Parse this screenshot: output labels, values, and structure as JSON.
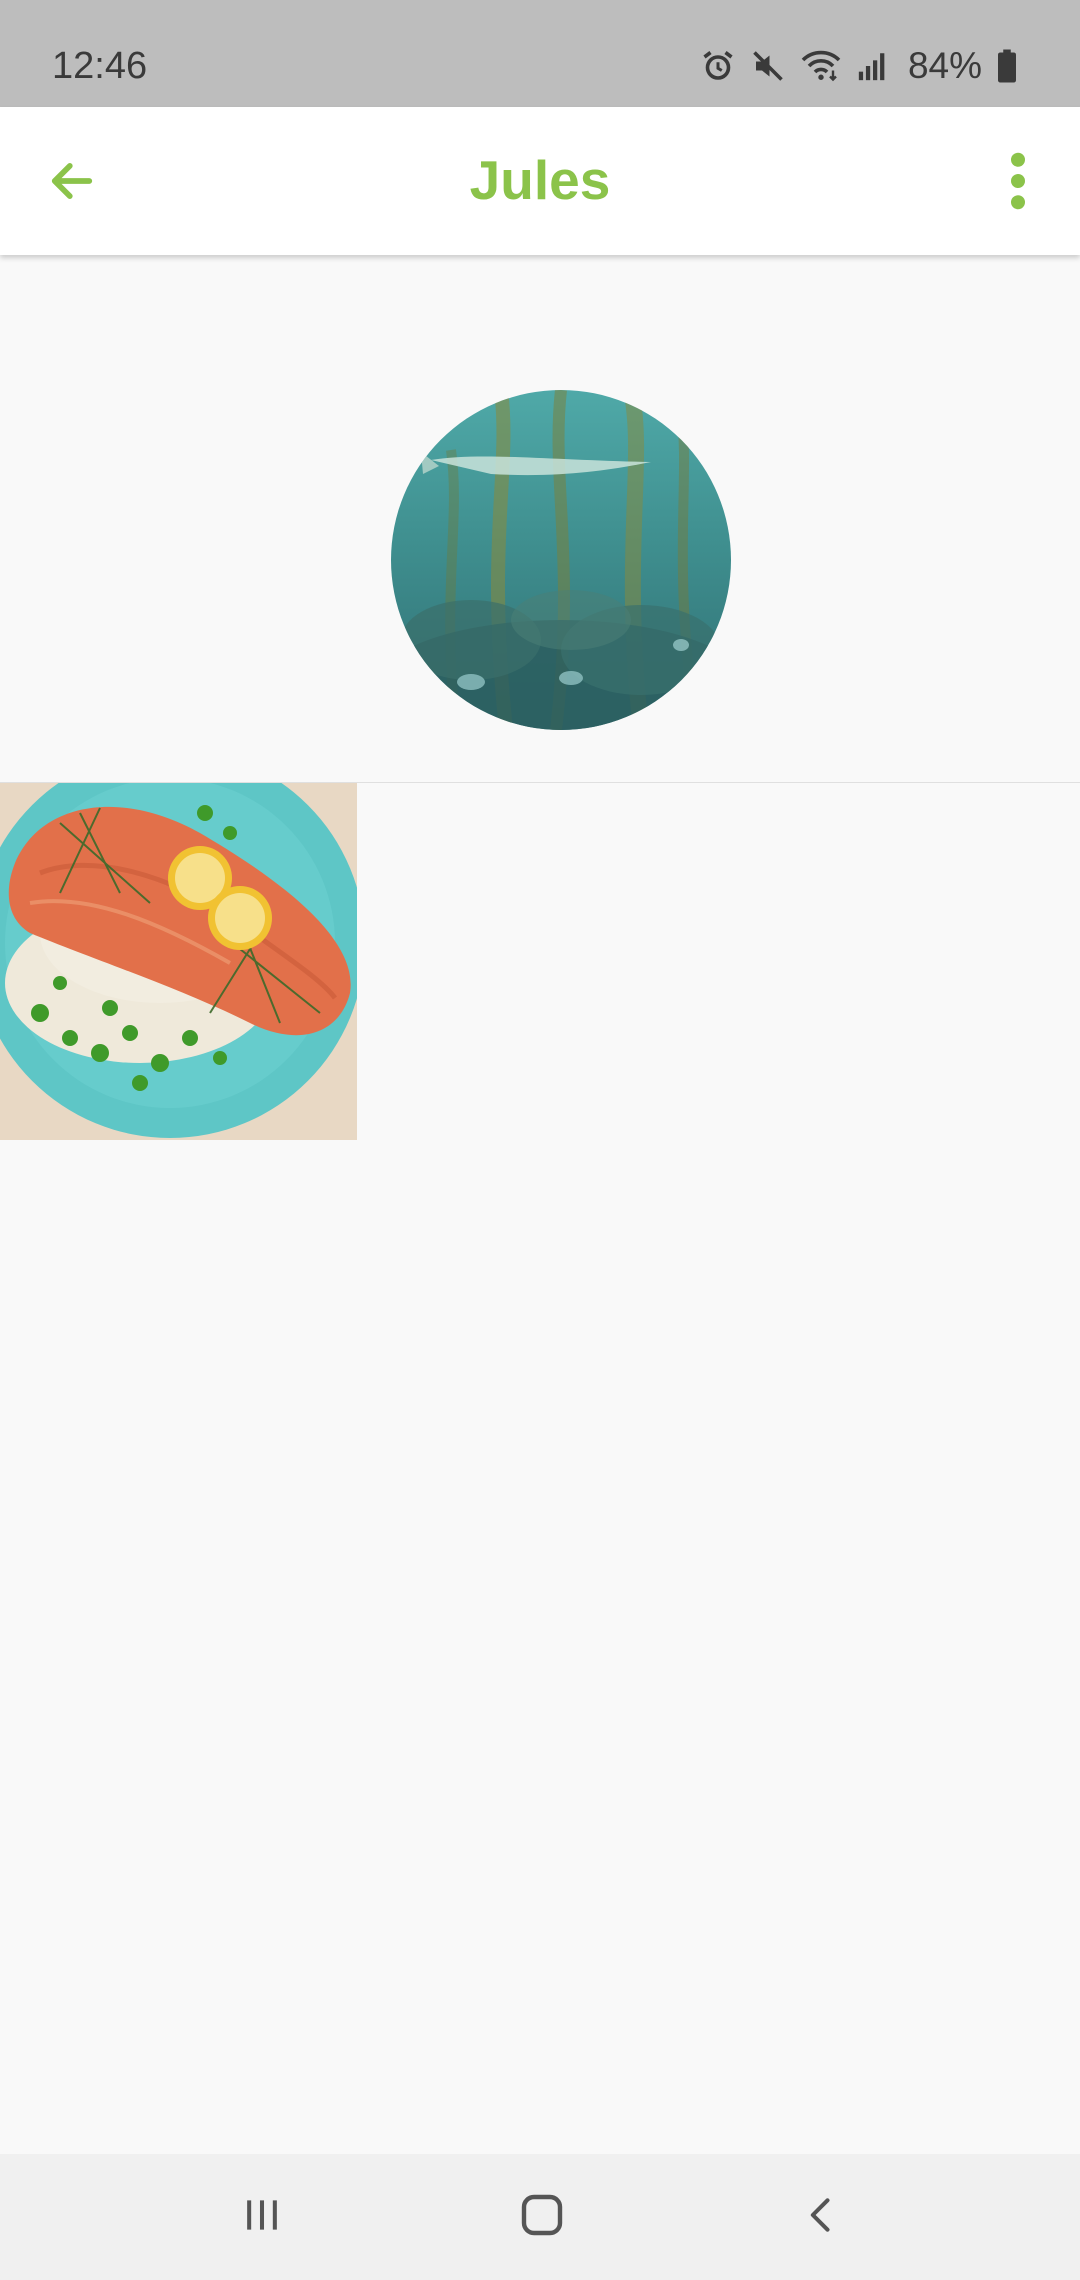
{
  "status_bar": {
    "time": "12:46",
    "battery_percent": "84%",
    "icons": [
      "alarm-icon",
      "mute-icon",
      "wifi-icon",
      "signal-icon",
      "battery-icon"
    ]
  },
  "app_bar": {
    "title": "Jules",
    "back_icon": "arrow-left-icon",
    "menu_icon": "more-vertical-icon",
    "accent_color": "#8bc34a"
  },
  "profile": {
    "avatar_description": "underwater-kelp-forest-with-shark"
  },
  "photos": [
    {
      "description": "salmon-fillet-with-lemon-rice-and-peas"
    }
  ],
  "nav_bar": {
    "buttons": [
      "recent-apps-icon",
      "home-icon",
      "back-icon"
    ]
  }
}
